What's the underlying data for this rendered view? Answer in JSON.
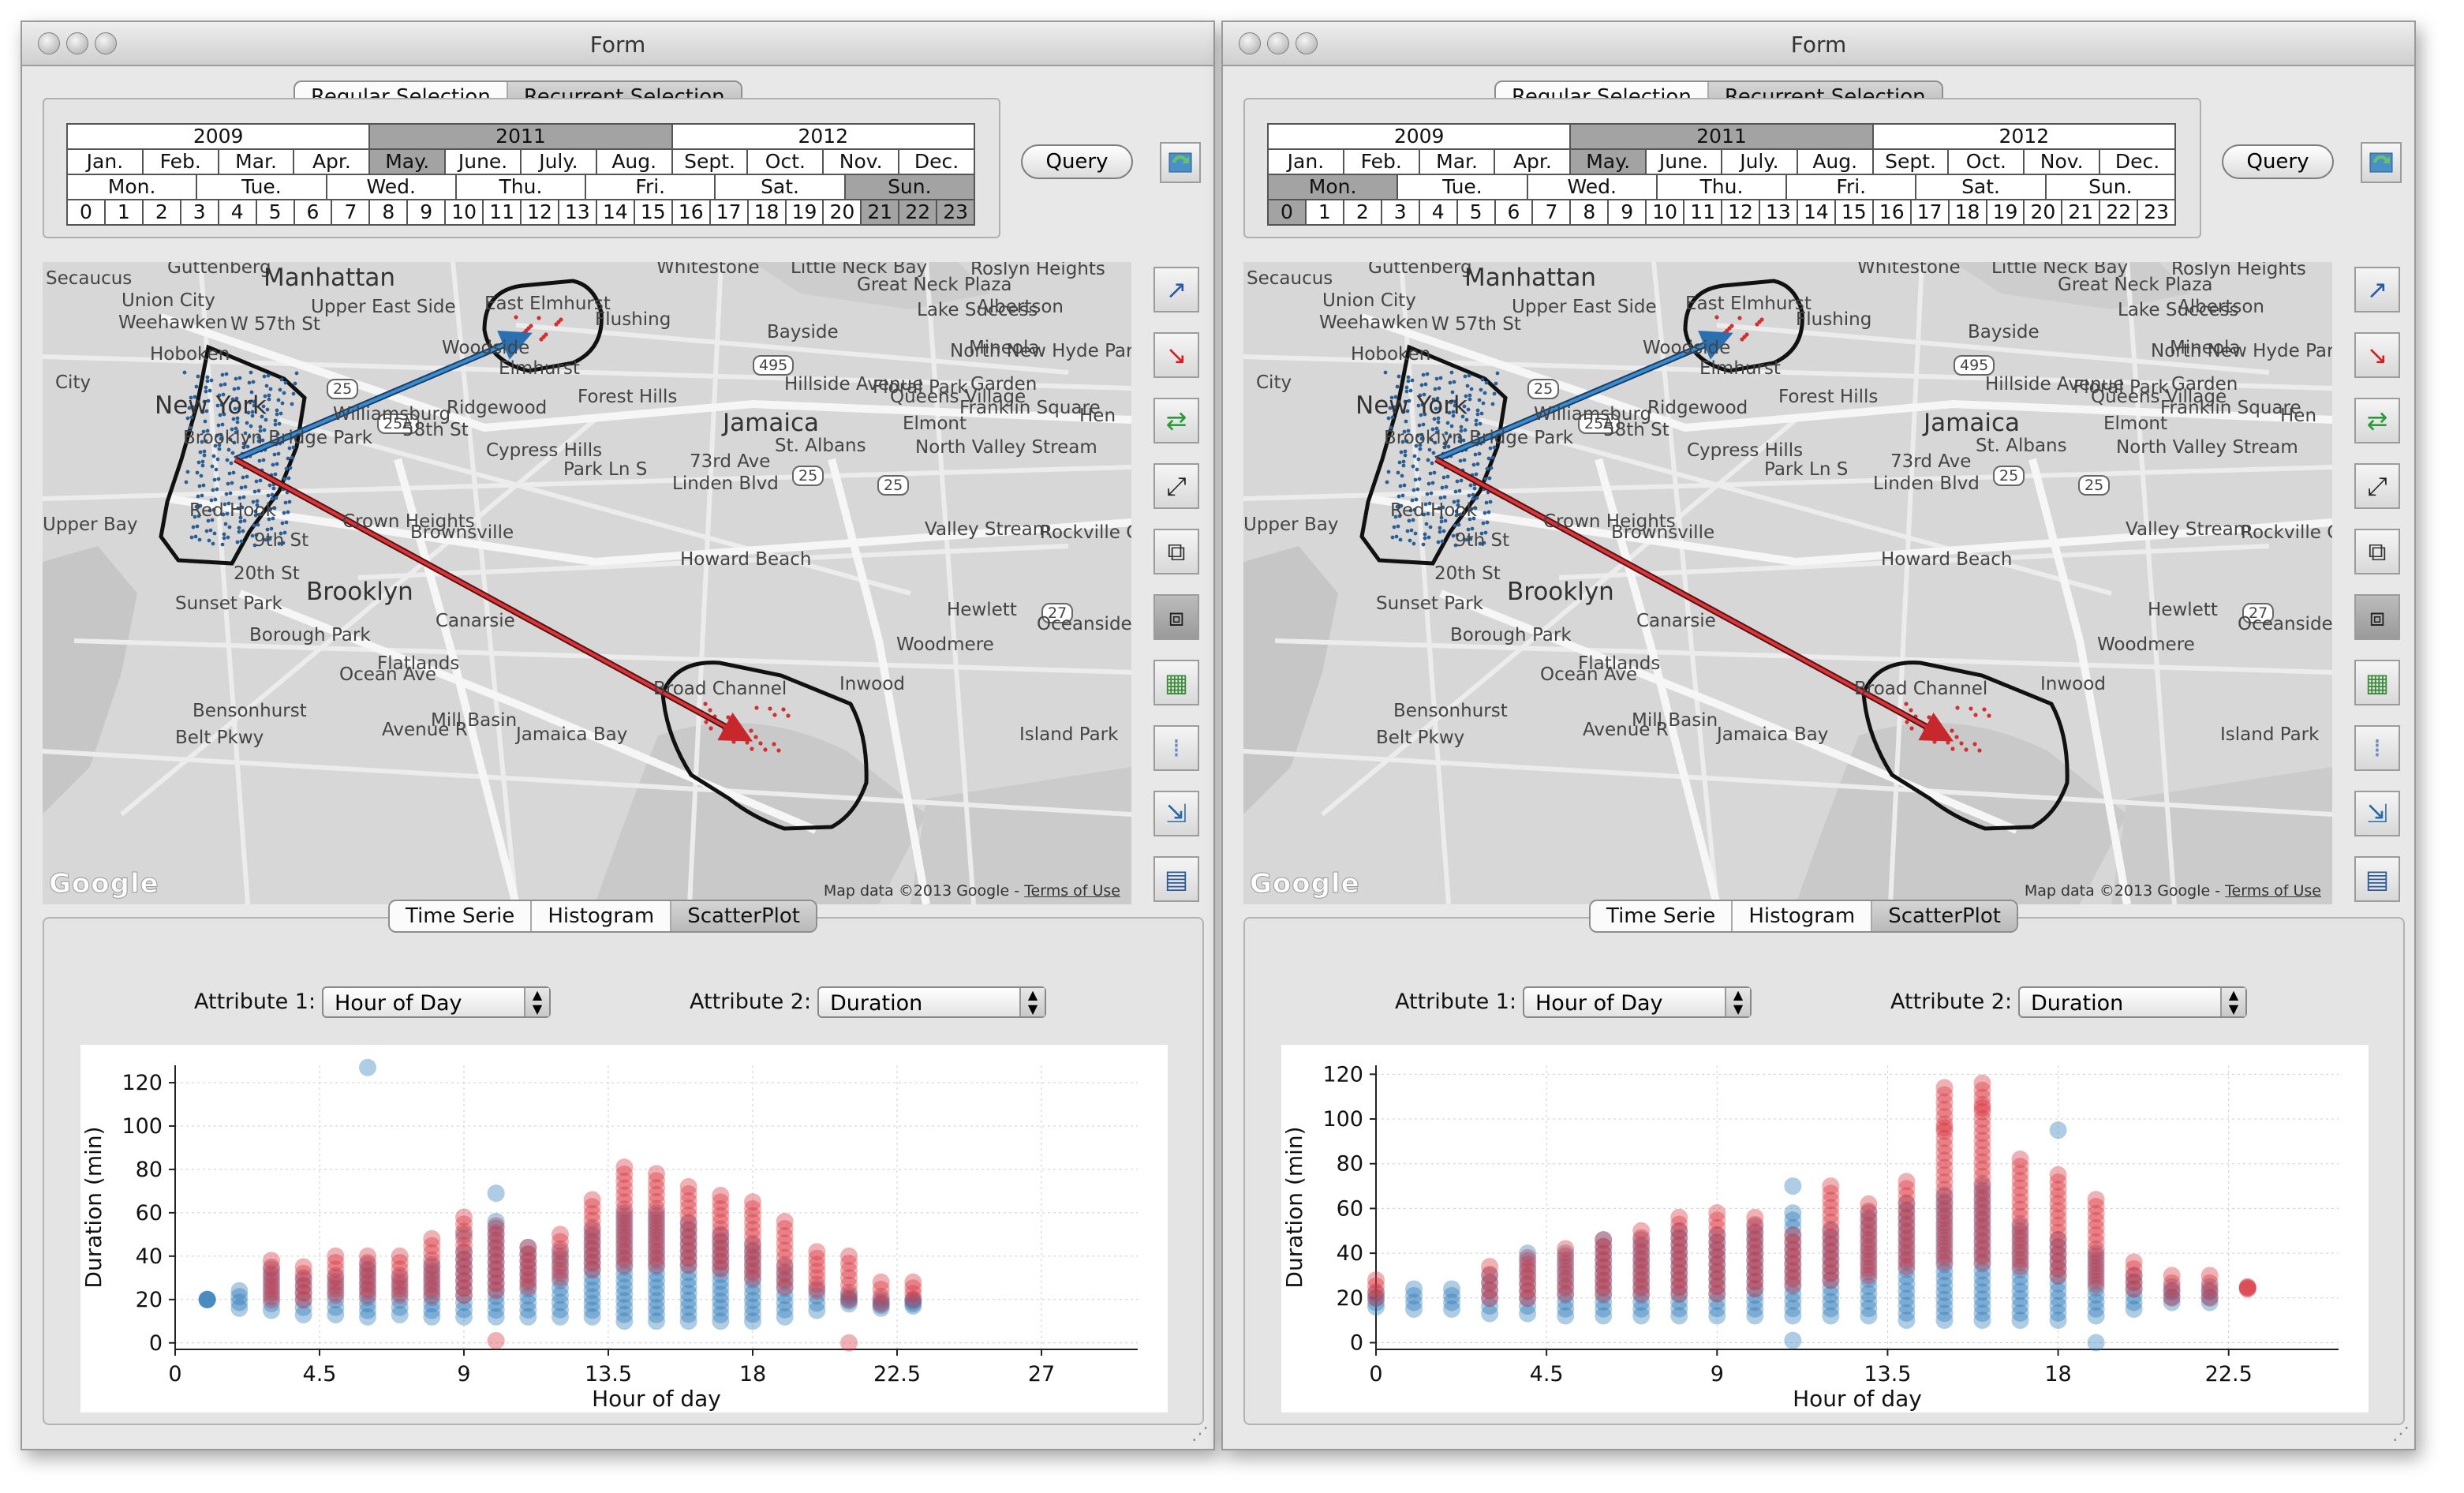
{
  "windows": [
    {
      "title": "Form",
      "selection_tabs": [
        "Regular Selection",
        "Recurrent Selection"
      ],
      "active_selection_tab": 1,
      "calendar": {
        "years": [
          "2009",
          "2011",
          "2012"
        ],
        "months": [
          "Jan.",
          "Feb.",
          "Mar.",
          "Apr.",
          "May.",
          "June.",
          "July.",
          "Aug.",
          "Sept.",
          "Oct.",
          "Nov.",
          "Dec."
        ],
        "weekdays": [
          "Mon.",
          "Tue.",
          "Wed.",
          "Thu.",
          "Fri.",
          "Sat.",
          "Sun."
        ],
        "hours": [
          "0",
          "1",
          "2",
          "3",
          "4",
          "5",
          "6",
          "7",
          "8",
          "9",
          "10",
          "11",
          "12",
          "13",
          "14",
          "15",
          "16",
          "17",
          "18",
          "19",
          "20",
          "21",
          "22",
          "23"
        ],
        "selected_year": "2011",
        "selected_month": "May.",
        "selected_weekday": "Sun.",
        "selected_hours": [
          "21",
          "22",
          "23"
        ]
      },
      "query_label": "Query",
      "map": {
        "labels": [
          "Secaucus",
          "Guttenberg",
          "Manhattan",
          "Union City",
          "Upper East Side",
          "Weehawken",
          "W 57th St",
          "Hoboken",
          "City",
          "New York",
          "Whitestone",
          "Little Neck Bay",
          "Great Neck Plaza",
          "Roslyn Heights",
          "East Elmhurst",
          "Flushing",
          "Lake Success",
          "Albertson",
          "Bayside",
          "Mineola",
          "North New Hyde Park",
          "Woodside",
          "Elmhurst",
          "Forest Hills",
          "Floral Park",
          "Garden",
          "Queens Village",
          "Franklin Square",
          "Hen",
          "Ridgewood",
          "Williamsburg",
          "Jamaica",
          "Elmont",
          "Brooklyn Bridge Park",
          "Cypress Hills",
          "St. Albans",
          "North Valley Stream",
          "Red Hook",
          "Crown Heights",
          "Brownsville",
          "Howard Beach",
          "Valley Stream",
          "Rockville Centre",
          "Brooklyn",
          "Sunset Park",
          "Canarsie",
          "Hewlett",
          "Oceanside",
          "Borough Park",
          "Flatlands",
          "Woodmere",
          "Broad Channel",
          "Inwood",
          "Bensonhurst",
          "Mill Basin",
          "Jamaica Bay",
          "Island Park",
          "Avenue R",
          "Belt Pkwy",
          "Ocean Ave",
          "Park Ln S",
          "Linden Blvd",
          "Hillside Avenue",
          "73rd Ave",
          "58th St",
          "9th St",
          "20th St",
          "Upper Bay"
        ],
        "attribution": "Map data ©2013 Google -",
        "terms": "Terms of Use",
        "logo": "Google",
        "route_shields": [
          "25",
          "25A",
          "495",
          "25",
          "25",
          "27"
        ]
      },
      "tools": [
        "select-origin-icon",
        "select-destination-icon",
        "select-both-icon",
        "select-od-icon",
        "link-regions-icon",
        "link-regions-dark-icon",
        "map-layer-icon",
        "grid-dots-icon",
        "export-table-icon",
        "table-icon"
      ],
      "chart_tabs": [
        "Time Serie",
        "Histogram",
        "ScatterPlot"
      ],
      "active_chart_tab": 2,
      "attribute1_label": "Attribute 1:",
      "attribute1_value": "Hour of Day",
      "attribute2_label": "Attribute 2:",
      "attribute2_value": "Duration",
      "chart_data": {
        "type": "scatter",
        "xlabel": "Hour of day",
        "ylabel": "Duration (min)",
        "xlim": [
          0,
          30
        ],
        "ylim": [
          -3,
          128
        ],
        "xticks": [
          0,
          4.5,
          9,
          13.5,
          18,
          22.5,
          27
        ],
        "yticks": [
          0,
          20,
          40,
          60,
          80,
          100,
          120
        ],
        "series": [
          {
            "color": "#2a7ab8",
            "columns": [
              [
                1,
                20,
                20
              ],
              [
                2,
                16,
                24
              ],
              [
                3,
                15,
                34
              ],
              [
                4,
                13,
                30
              ],
              [
                5,
                13,
                30
              ],
              [
                6,
                12,
                36
              ],
              [
                7,
                13,
                30
              ],
              [
                8,
                12,
                36
              ],
              [
                9,
                12,
                42
              ],
              [
                10,
                12,
                56
              ],
              [
                11,
                12,
                44
              ],
              [
                12,
                12,
                42
              ],
              [
                13,
                12,
                52
              ],
              [
                14,
                10,
                60
              ],
              [
                15,
                10,
                60
              ],
              [
                16,
                10,
                55
              ],
              [
                17,
                10,
                50
              ],
              [
                18,
                10,
                45
              ],
              [
                19,
                12,
                35
              ],
              [
                20,
                15,
                25
              ],
              [
                21,
                18,
                22
              ],
              [
                22,
                16,
                20
              ],
              [
                23,
                17,
                20
              ]
            ],
            "extra": [
              [
                6,
                127
              ],
              [
                10,
                69
              ],
              [
                9,
                50
              ]
            ]
          },
          {
            "color": "#d8323c",
            "columns": [
              [
                3,
                20,
                38
              ],
              [
                4,
                20,
                35
              ],
              [
                5,
                22,
                40
              ],
              [
                6,
                22,
                40
              ],
              [
                7,
                22,
                40
              ],
              [
                8,
                22,
                48
              ],
              [
                9,
                22,
                58
              ],
              [
                10,
                24,
                54
              ],
              [
                11,
                26,
                44
              ],
              [
                12,
                30,
                50
              ],
              [
                13,
                34,
                66
              ],
              [
                14,
                36,
                81
              ],
              [
                15,
                36,
                78
              ],
              [
                16,
                36,
                72
              ],
              [
                17,
                34,
                68
              ],
              [
                18,
                30,
                65
              ],
              [
                19,
                26,
                56
              ],
              [
                20,
                24,
                42
              ],
              [
                21,
                20,
                40
              ],
              [
                22,
                18,
                28
              ],
              [
                23,
                20,
                28
              ]
            ],
            "extra": [
              [
                10,
                1
              ],
              [
                21,
                0
              ]
            ]
          }
        ]
      }
    },
    {
      "title": "Form",
      "selection_tabs": [
        "Regular Selection",
        "Recurrent Selection"
      ],
      "active_selection_tab": 1,
      "calendar": {
        "years": [
          "2009",
          "2011",
          "2012"
        ],
        "months": [
          "Jan.",
          "Feb.",
          "Mar.",
          "Apr.",
          "May.",
          "June.",
          "July.",
          "Aug.",
          "Sept.",
          "Oct.",
          "Nov.",
          "Dec."
        ],
        "weekdays": [
          "Mon.",
          "Tue.",
          "Wed.",
          "Thu.",
          "Fri.",
          "Sat.",
          "Sun."
        ],
        "hours": [
          "0",
          "1",
          "2",
          "3",
          "4",
          "5",
          "6",
          "7",
          "8",
          "9",
          "10",
          "11",
          "12",
          "13",
          "14",
          "15",
          "16",
          "17",
          "18",
          "19",
          "20",
          "21",
          "22",
          "23"
        ],
        "selected_year": "2011",
        "selected_month": "May.",
        "selected_weekday": "Mon.",
        "selected_hours": [
          "0"
        ]
      },
      "query_label": "Query",
      "map": {
        "labels": [
          "Secaucus",
          "Guttenberg",
          "Manhattan",
          "Union City",
          "Upper East Side",
          "Weehawken",
          "W 57th St",
          "Hoboken",
          "City",
          "New York",
          "Whitestone",
          "Little Neck Bay",
          "Great Neck Plaza",
          "Roslyn Heights",
          "East Elmhurst",
          "Flushing",
          "Lake Success",
          "Albertson",
          "Bayside",
          "Mineola",
          "North New Hyde Park",
          "Woodside",
          "Elmhurst",
          "Forest Hills",
          "Floral Park",
          "Garden",
          "Queens Village",
          "Franklin Square",
          "Hen",
          "Ridgewood",
          "Williamsburg",
          "Jamaica",
          "Elmont",
          "Brooklyn Bridge Park",
          "Cypress Hills",
          "St. Albans",
          "North Valley Stream",
          "Red Hook",
          "Crown Heights",
          "Brownsville",
          "Howard Beach",
          "Valley Stream",
          "Rockville Centre",
          "Brooklyn",
          "Sunset Park",
          "Canarsie",
          "Hewlett",
          "Oceanside",
          "Borough Park",
          "Flatlands",
          "Woodmere",
          "Broad Channel",
          "Inwood",
          "Bensonhurst",
          "Mill Basin",
          "Jamaica Bay",
          "Island Park",
          "Avenue R",
          "Belt Pkwy",
          "Ocean Ave",
          "Park Ln S",
          "Linden Blvd",
          "Hillside Avenue",
          "73rd Ave",
          "58th St",
          "9th St",
          "20th St",
          "Upper Bay"
        ],
        "attribution": "Map data ©2013 Google -",
        "terms": "Terms of Use",
        "logo": "Google",
        "route_shields": [
          "25",
          "25A",
          "495",
          "25",
          "25",
          "27"
        ]
      },
      "tools": [
        "select-origin-icon",
        "select-destination-icon",
        "select-both-icon",
        "select-od-icon",
        "link-regions-icon",
        "link-regions-dark-icon",
        "map-layer-icon",
        "grid-dots-icon",
        "export-table-icon",
        "table-icon"
      ],
      "chart_tabs": [
        "Time Serie",
        "Histogram",
        "ScatterPlot"
      ],
      "active_chart_tab": 2,
      "attribute1_label": "Attribute 1:",
      "attribute1_value": "Hour of Day",
      "attribute2_label": "Attribute 2:",
      "attribute2_value": "Duration",
      "chart_data": {
        "type": "scatter",
        "xlabel": "Hour of day",
        "ylabel": "Duration (min)",
        "xlim": [
          0,
          25.4
        ],
        "ylim": [
          -3,
          124
        ],
        "xticks": [
          0,
          4.5,
          9,
          13.5,
          18,
          22.5
        ],
        "yticks": [
          0,
          20,
          40,
          60,
          80,
          100,
          120
        ],
        "series": [
          {
            "color": "#2a7ab8",
            "columns": [
              [
                0,
                16,
                22
              ],
              [
                1,
                15,
                24
              ],
              [
                2,
                15,
                24
              ],
              [
                3,
                13,
                30
              ],
              [
                4,
                13,
                40
              ],
              [
                5,
                12,
                40
              ],
              [
                6,
                12,
                46
              ],
              [
                7,
                12,
                46
              ],
              [
                8,
                12,
                50
              ],
              [
                9,
                12,
                48
              ],
              [
                10,
                12,
                52
              ],
              [
                11,
                12,
                58
              ],
              [
                12,
                12,
                50
              ],
              [
                13,
                12,
                58
              ],
              [
                14,
                10,
                62
              ],
              [
                15,
                10,
                66
              ],
              [
                16,
                10,
                70
              ],
              [
                17,
                10,
                52
              ],
              [
                18,
                10,
                46
              ],
              [
                19,
                12,
                40
              ],
              [
                20,
                15,
                30
              ],
              [
                21,
                18,
                25
              ],
              [
                22,
                18,
                25
              ]
            ],
            "extra": [
              [
                11,
                1
              ],
              [
                19,
                0
              ],
              [
                18,
                95
              ],
              [
                11,
                70
              ]
            ]
          },
          {
            "color": "#d8323c",
            "columns": [
              [
                0,
                20,
                28
              ],
              [
                3,
                20,
                34
              ],
              [
                4,
                20,
                38
              ],
              [
                5,
                22,
                42
              ],
              [
                6,
                22,
                46
              ],
              [
                7,
                22,
                50
              ],
              [
                8,
                22,
                56
              ],
              [
                9,
                22,
                58
              ],
              [
                10,
                24,
                56
              ],
              [
                11,
                26,
                48
              ],
              [
                12,
                28,
                70
              ],
              [
                13,
                30,
                62
              ],
              [
                14,
                34,
                72
              ],
              [
                15,
                36,
                114
              ],
              [
                16,
                36,
                116
              ],
              [
                17,
                34,
                82
              ],
              [
                18,
                30,
                75
              ],
              [
                19,
                26,
                64
              ],
              [
                20,
                24,
                36
              ],
              [
                21,
                20,
                30
              ],
              [
                22,
                20,
                30
              ],
              [
                23,
                24,
                25
              ]
            ],
            "extra": [
              [
                16,
                105
              ],
              [
                15,
                96
              ]
            ]
          }
        ]
      }
    }
  ]
}
